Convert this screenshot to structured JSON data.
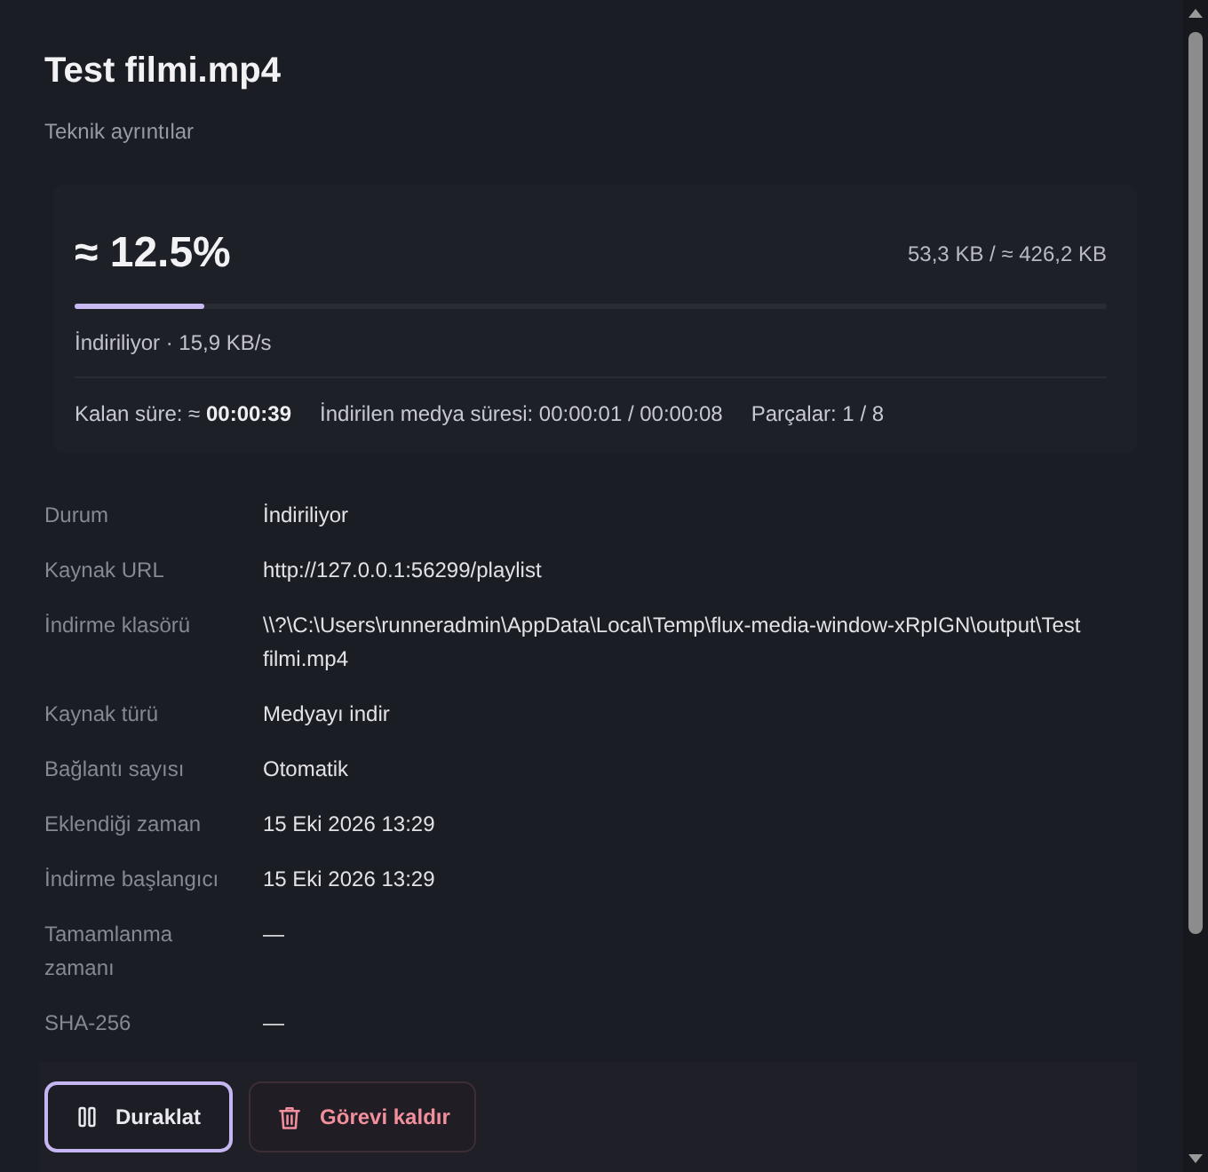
{
  "title": "Test filmi.mp4",
  "subtitle": "Teknik ayrıntılar",
  "progress": {
    "percent": "≈ 12.5%",
    "size": "53,3 KB / ≈ 426,2 KB",
    "level": 0.125,
    "status": "İndiriliyor · 15,9 KB/s",
    "stats": [
      "Kalan süre: ≈ **00:00:39**",
      "İndirilen medya süresi: 00:00:01 / 00:00:08",
      "Parçalar: 1 / 8"
    ]
  },
  "details": [
    {
      "label": "Durum",
      "value": "İndiriliyor"
    },
    {
      "label": "Kaynak URL",
      "value": "http://127.0.0.1:56299/playlist"
    },
    {
      "label": "İndirme klasörü",
      "value": "\\\\?\\C:\\Users\\runneradmin\\AppData\\Local\\Temp\\flux-media-window-xRpIGN\\output\\Test filmi.mp4"
    },
    {
      "label": "Kaynak türü",
      "value": "Medyayı indir"
    },
    {
      "label": "Bağlantı sayısı",
      "value": "Otomatik"
    },
    {
      "label": "Eklendiği zaman",
      "value": "15 Eki 2026 13:29"
    },
    {
      "label": "İndirme başlangıcı",
      "value": "15 Eki 2026 13:29"
    },
    {
      "label": "Tamamlanma zamanı",
      "value": "—"
    },
    {
      "label": "SHA-256",
      "value": "—"
    }
  ],
  "buttons": [
    {
      "kind": "pause",
      "label": "Duraklat",
      "focused": true
    },
    {
      "kind": "remove",
      "label": "Görevi kaldır",
      "focused": false
    }
  ]
}
